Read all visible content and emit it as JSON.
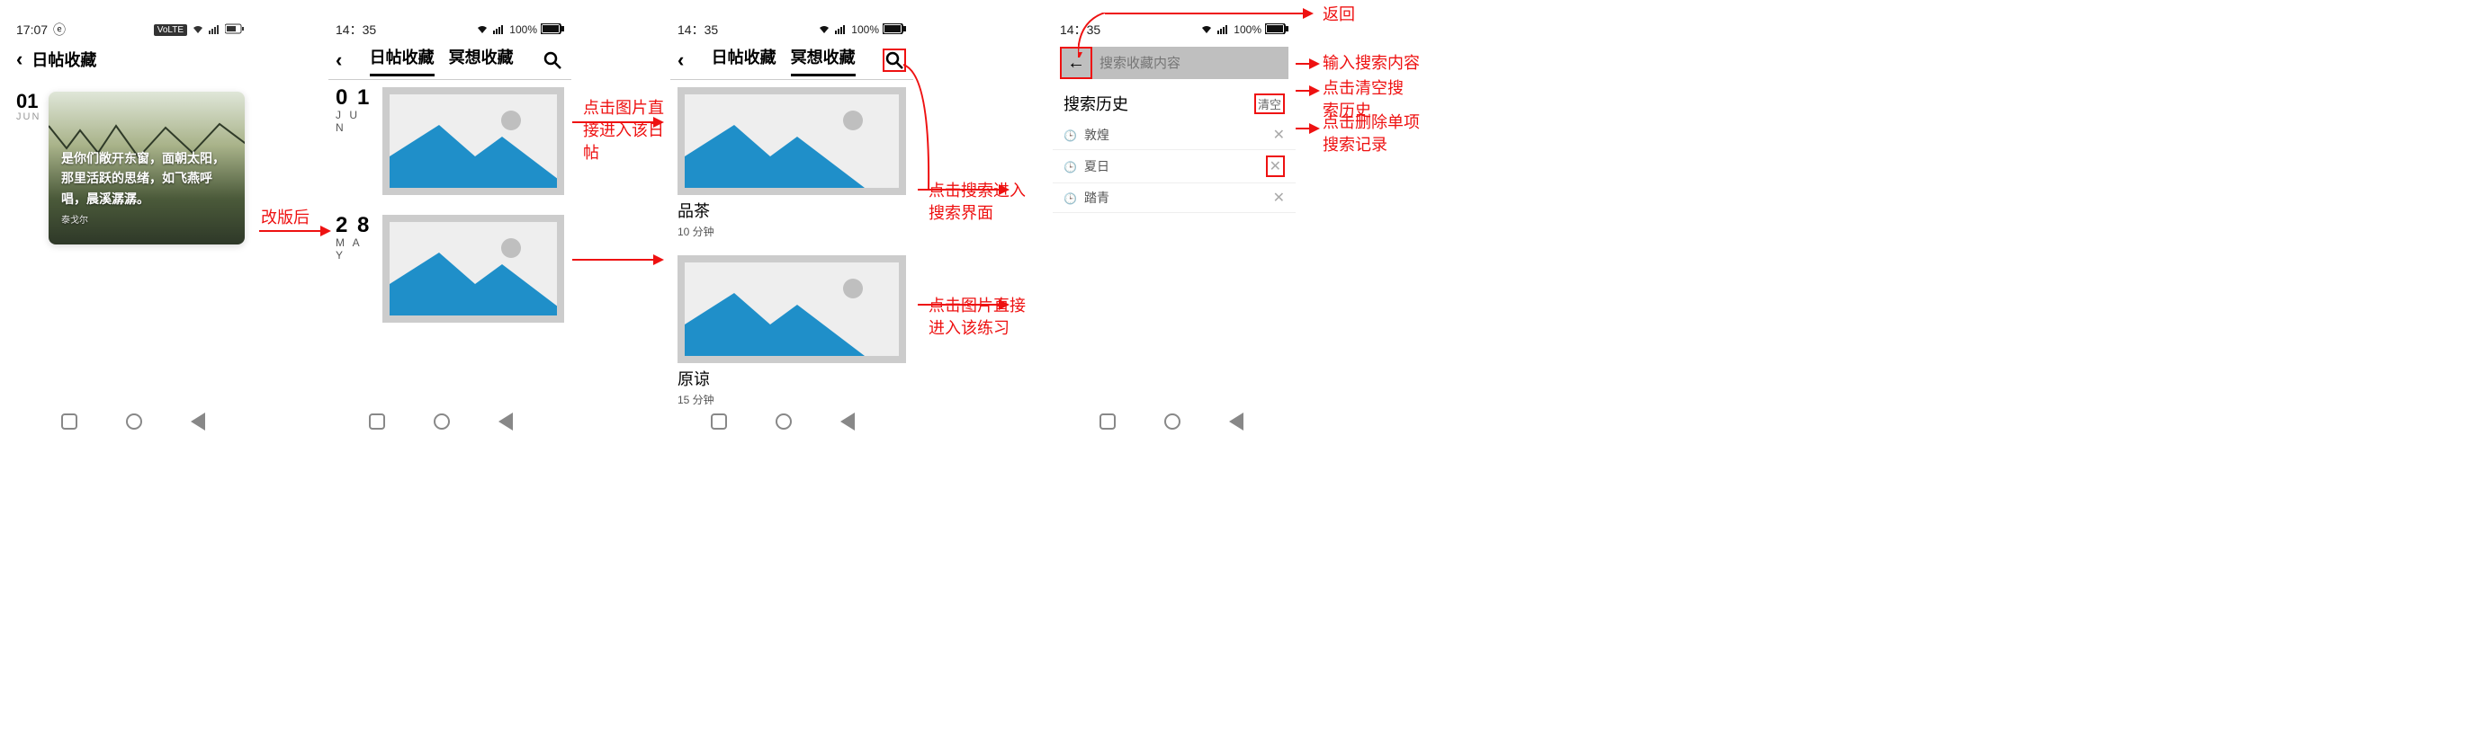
{
  "screen1": {
    "status": {
      "time": "17:07",
      "extra": "ⓔ",
      "volte": "VoLTE",
      "battery": "■"
    },
    "header_title": "日帖收藏",
    "date": {
      "day": "01",
      "mon": "JUN"
    },
    "card_caption": "是你们敞开东窗，面朝太阳，那里活跃的思绪，如飞燕呼唱，晨溪潺潺。",
    "card_author": "泰戈尔"
  },
  "screen2": {
    "status": {
      "time": "14：35",
      "battery_pct": "100%"
    },
    "tab1": "日帖收藏",
    "tab2": "冥想收藏",
    "posts": [
      {
        "day": "0 1",
        "mon": "J U N"
      },
      {
        "day": "2 8",
        "mon": "M A Y"
      }
    ]
  },
  "screen3": {
    "status": {
      "time": "14：35",
      "battery_pct": "100%"
    },
    "tab1": "日帖收藏",
    "tab2": "冥想收藏",
    "items": [
      {
        "title": "品茶",
        "sub": "10 分钟"
      },
      {
        "title": "原谅",
        "sub": "15 分钟"
      }
    ]
  },
  "screen4": {
    "status": {
      "time": "14：35",
      "battery_pct": "100%"
    },
    "search_placeholder": "搜索收藏内容",
    "history_title": "搜索历史",
    "clear_label": "清空",
    "history": [
      {
        "term": "敦煌"
      },
      {
        "term": "夏日"
      },
      {
        "term": "踏青"
      }
    ]
  },
  "annotations": {
    "revised": "改版后",
    "click_image_daily": "点击图片直接进入该日帖",
    "click_search": "点击搜索进入搜索界面",
    "click_image_practice": "点击图片直接进入该练习",
    "return": "返回",
    "input_search": "输入搜索内容",
    "click_clear": "点击清空搜索历史",
    "click_delete_item": "点击删除单项搜索记录"
  }
}
